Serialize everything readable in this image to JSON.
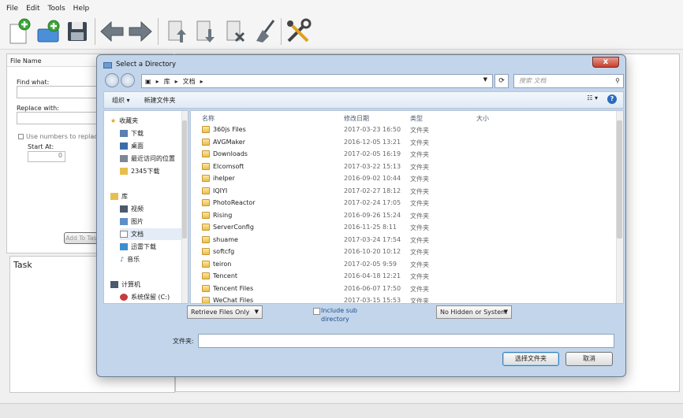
{
  "menu": [
    "File",
    "Edit",
    "Tools",
    "Help"
  ],
  "left_panel": {
    "file_name_header": "File Name",
    "find_what_label": "Find what:",
    "replace_with_label": "Replace with:",
    "use_numbers_label": "Use numbers to replace '#'",
    "start_at_label": "Start At:",
    "start_at_value": "0",
    "add_to_button": "Add To Task"
  },
  "task_panel": {
    "title": "Task"
  },
  "dialog": {
    "title": "Select a Directory",
    "close_glyph": "x",
    "address": {
      "crumb1": "库",
      "crumb2": "文档"
    },
    "search_placeholder": "搜索 文档",
    "toolbar": {
      "organize": "组织",
      "new_folder": "新建文件夹"
    },
    "nav": {
      "favorites": "收藏夹",
      "downloads": "下载",
      "desktop": "桌面",
      "recent": "最近访问的位置",
      "download2345": "2345下载",
      "libraries": "库",
      "videos": "视频",
      "pictures": "图片",
      "documents": "文档",
      "xunlei": "迅雷下载",
      "music": "音乐",
      "computer": "计算机",
      "system_drive": "系统保留 (C:)"
    },
    "columns": {
      "name": "名称",
      "modified": "修改日期",
      "type": "类型",
      "size": "大小"
    },
    "files": [
      {
        "name": "360js Files",
        "date": "2017-03-23 16:50",
        "type": "文件夹"
      },
      {
        "name": "AVGMaker",
        "date": "2016-12-05 13:21",
        "type": "文件夹"
      },
      {
        "name": "Downloads",
        "date": "2017-02-05 16:19",
        "type": "文件夹"
      },
      {
        "name": "Elcomsoft",
        "date": "2017-03-22 15:13",
        "type": "文件夹"
      },
      {
        "name": "ihelper",
        "date": "2016-09-02 10:44",
        "type": "文件夹"
      },
      {
        "name": "IQIYI",
        "date": "2017-02-27 18:12",
        "type": "文件夹"
      },
      {
        "name": "PhotoReactor",
        "date": "2017-02-24 17:05",
        "type": "文件夹"
      },
      {
        "name": "Rising",
        "date": "2016-09-26 15:24",
        "type": "文件夹"
      },
      {
        "name": "ServerConfig",
        "date": "2016-11-25 8:11",
        "type": "文件夹"
      },
      {
        "name": "shuame",
        "date": "2017-03-24 17:54",
        "type": "文件夹"
      },
      {
        "name": "softcfg",
        "date": "2016-10-20 10:12",
        "type": "文件夹"
      },
      {
        "name": "teiron",
        "date": "2017-02-05 9:59",
        "type": "文件夹"
      },
      {
        "name": "Tencent",
        "date": "2016-04-18 12:21",
        "type": "文件夹"
      },
      {
        "name": "Tencent Files",
        "date": "2016-06-07 17:50",
        "type": "文件夹"
      },
      {
        "name": "WeChat Files",
        "date": "2017-03-15 15:53",
        "type": "文件夹"
      }
    ],
    "retrieve_dropdown": "Retrieve Files Only",
    "include_sub": "Include sub directory",
    "hidden_dropdown": "No Hidden or System",
    "folder_label": "文件夹:",
    "folder_value": "",
    "select_button": "选择文件夹",
    "cancel_button": "取消"
  }
}
